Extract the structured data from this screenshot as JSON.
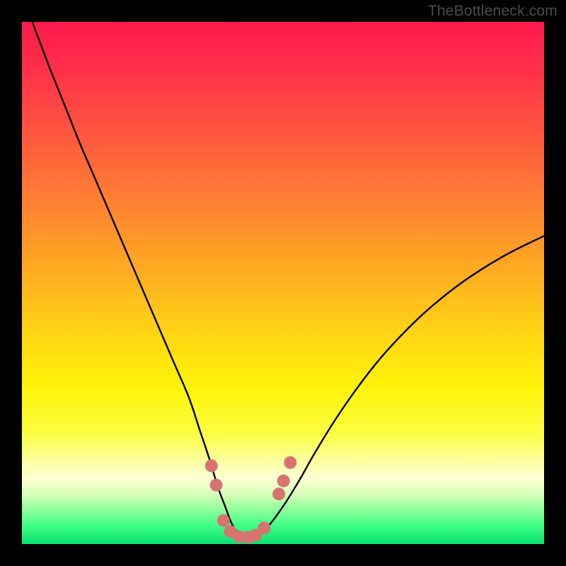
{
  "watermark": "TheBottleneck.com",
  "chart_data": {
    "type": "line",
    "title": "",
    "xlabel": "",
    "ylabel": "",
    "xlim": [
      0,
      100
    ],
    "ylim": [
      0,
      100
    ],
    "grid": false,
    "background_gradient": {
      "stops": [
        {
          "offset": 0.0,
          "color": "#ff1a4b"
        },
        {
          "offset": 0.09,
          "color": "#ff2f49"
        },
        {
          "offset": 0.2,
          "color": "#ff5240"
        },
        {
          "offset": 0.32,
          "color": "#ff7835"
        },
        {
          "offset": 0.45,
          "color": "#ffa324"
        },
        {
          "offset": 0.58,
          "color": "#ffcf15"
        },
        {
          "offset": 0.7,
          "color": "#fff308"
        },
        {
          "offset": 0.79,
          "color": "#fcff43"
        },
        {
          "offset": 0.845,
          "color": "#fdffa8"
        },
        {
          "offset": 0.875,
          "color": "#ffffd6"
        },
        {
          "offset": 0.905,
          "color": "#d6ffb8"
        },
        {
          "offset": 0.935,
          "color": "#8dff9a"
        },
        {
          "offset": 0.965,
          "color": "#3fff86"
        },
        {
          "offset": 1.0,
          "color": "#08e171"
        }
      ]
    },
    "series": [
      {
        "name": "bottleneck-curve",
        "x": [
          2,
          5,
          8,
          11,
          14,
          17,
          20,
          23,
          26,
          29,
          32,
          34,
          36,
          37.5,
          39,
          40,
          41,
          42,
          43.0,
          45,
          47,
          50,
          53,
          56,
          60,
          64,
          68,
          72,
          76,
          80,
          84,
          88,
          92,
          96,
          100
        ],
        "y": [
          100,
          92,
          84.5,
          77,
          70,
          63,
          56,
          49,
          42,
          35,
          28,
          22,
          16,
          11,
          7,
          4.3,
          2.6,
          1.5,
          1.0,
          1.5,
          3.2,
          7.2,
          12,
          17.3,
          23.8,
          29.6,
          34.8,
          39.3,
          43.3,
          46.8,
          49.9,
          52.6,
          55.0,
          57.1,
          59.0
        ]
      }
    ],
    "markers": {
      "name": "highlight-markers",
      "color": "#d77470",
      "points": [
        {
          "x": 36.3,
          "y": 15.0
        },
        {
          "x": 37.2,
          "y": 11.3
        },
        {
          "x": 38.6,
          "y": 4.5
        },
        {
          "x": 39.9,
          "y": 2.4
        },
        {
          "x": 41.6,
          "y": 1.4
        },
        {
          "x": 43.3,
          "y": 1.3
        },
        {
          "x": 44.8,
          "y": 1.7
        },
        {
          "x": 46.4,
          "y": 3.1
        },
        {
          "x": 49.2,
          "y": 9.6
        },
        {
          "x": 50.1,
          "y": 12.1
        },
        {
          "x": 51.4,
          "y": 15.6
        }
      ]
    }
  }
}
